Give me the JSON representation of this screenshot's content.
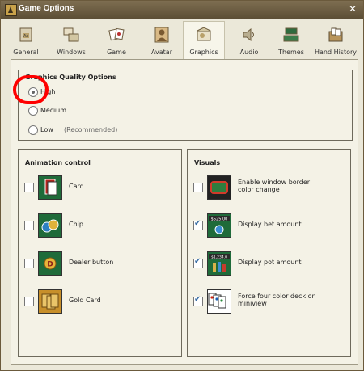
{
  "window": {
    "title": "Game Options",
    "close_label": "✕"
  },
  "tabs": [
    {
      "label": "General",
      "icon": "general-icon"
    },
    {
      "label": "Windows",
      "icon": "windows-icon"
    },
    {
      "label": "Game",
      "icon": "game-icon"
    },
    {
      "label": "Avatar",
      "icon": "avatar-icon"
    },
    {
      "label": "Graphics",
      "icon": "graphics-icon",
      "active": true
    },
    {
      "label": "Audio",
      "icon": "speaker-icon"
    },
    {
      "label": "Themes",
      "icon": "themes-icon"
    },
    {
      "label": "Hand History",
      "icon": "hand-history-icon"
    }
  ],
  "graphics_quality": {
    "title": "Graphics Quality Options",
    "options": [
      {
        "label": "High",
        "checked": true
      },
      {
        "label": "Medium",
        "checked": false
      },
      {
        "label": "Low",
        "checked": false,
        "note": "(Recommended)"
      }
    ]
  },
  "animation_control": {
    "title": "Animation control",
    "items": [
      {
        "label": "Card",
        "checked": false
      },
      {
        "label": "Chip",
        "checked": false
      },
      {
        "label": "Dealer button",
        "checked": false,
        "thumb_text": "D"
      },
      {
        "label": "Gold Card",
        "checked": false
      }
    ]
  },
  "visuals": {
    "title": "Visuals",
    "items": [
      {
        "label": "Enable window border color change",
        "checked": false
      },
      {
        "label": "Display bet amount",
        "checked": true,
        "thumb_text": "$525.00"
      },
      {
        "label": "Display pot amount",
        "checked": true,
        "thumb_text": "$1,234.0"
      },
      {
        "label": "Force four color deck on miniview",
        "checked": true
      }
    ]
  },
  "colors": {
    "accent": "#5c4e35",
    "highlight": "#ff0000",
    "felt": "#1f6b3a"
  }
}
